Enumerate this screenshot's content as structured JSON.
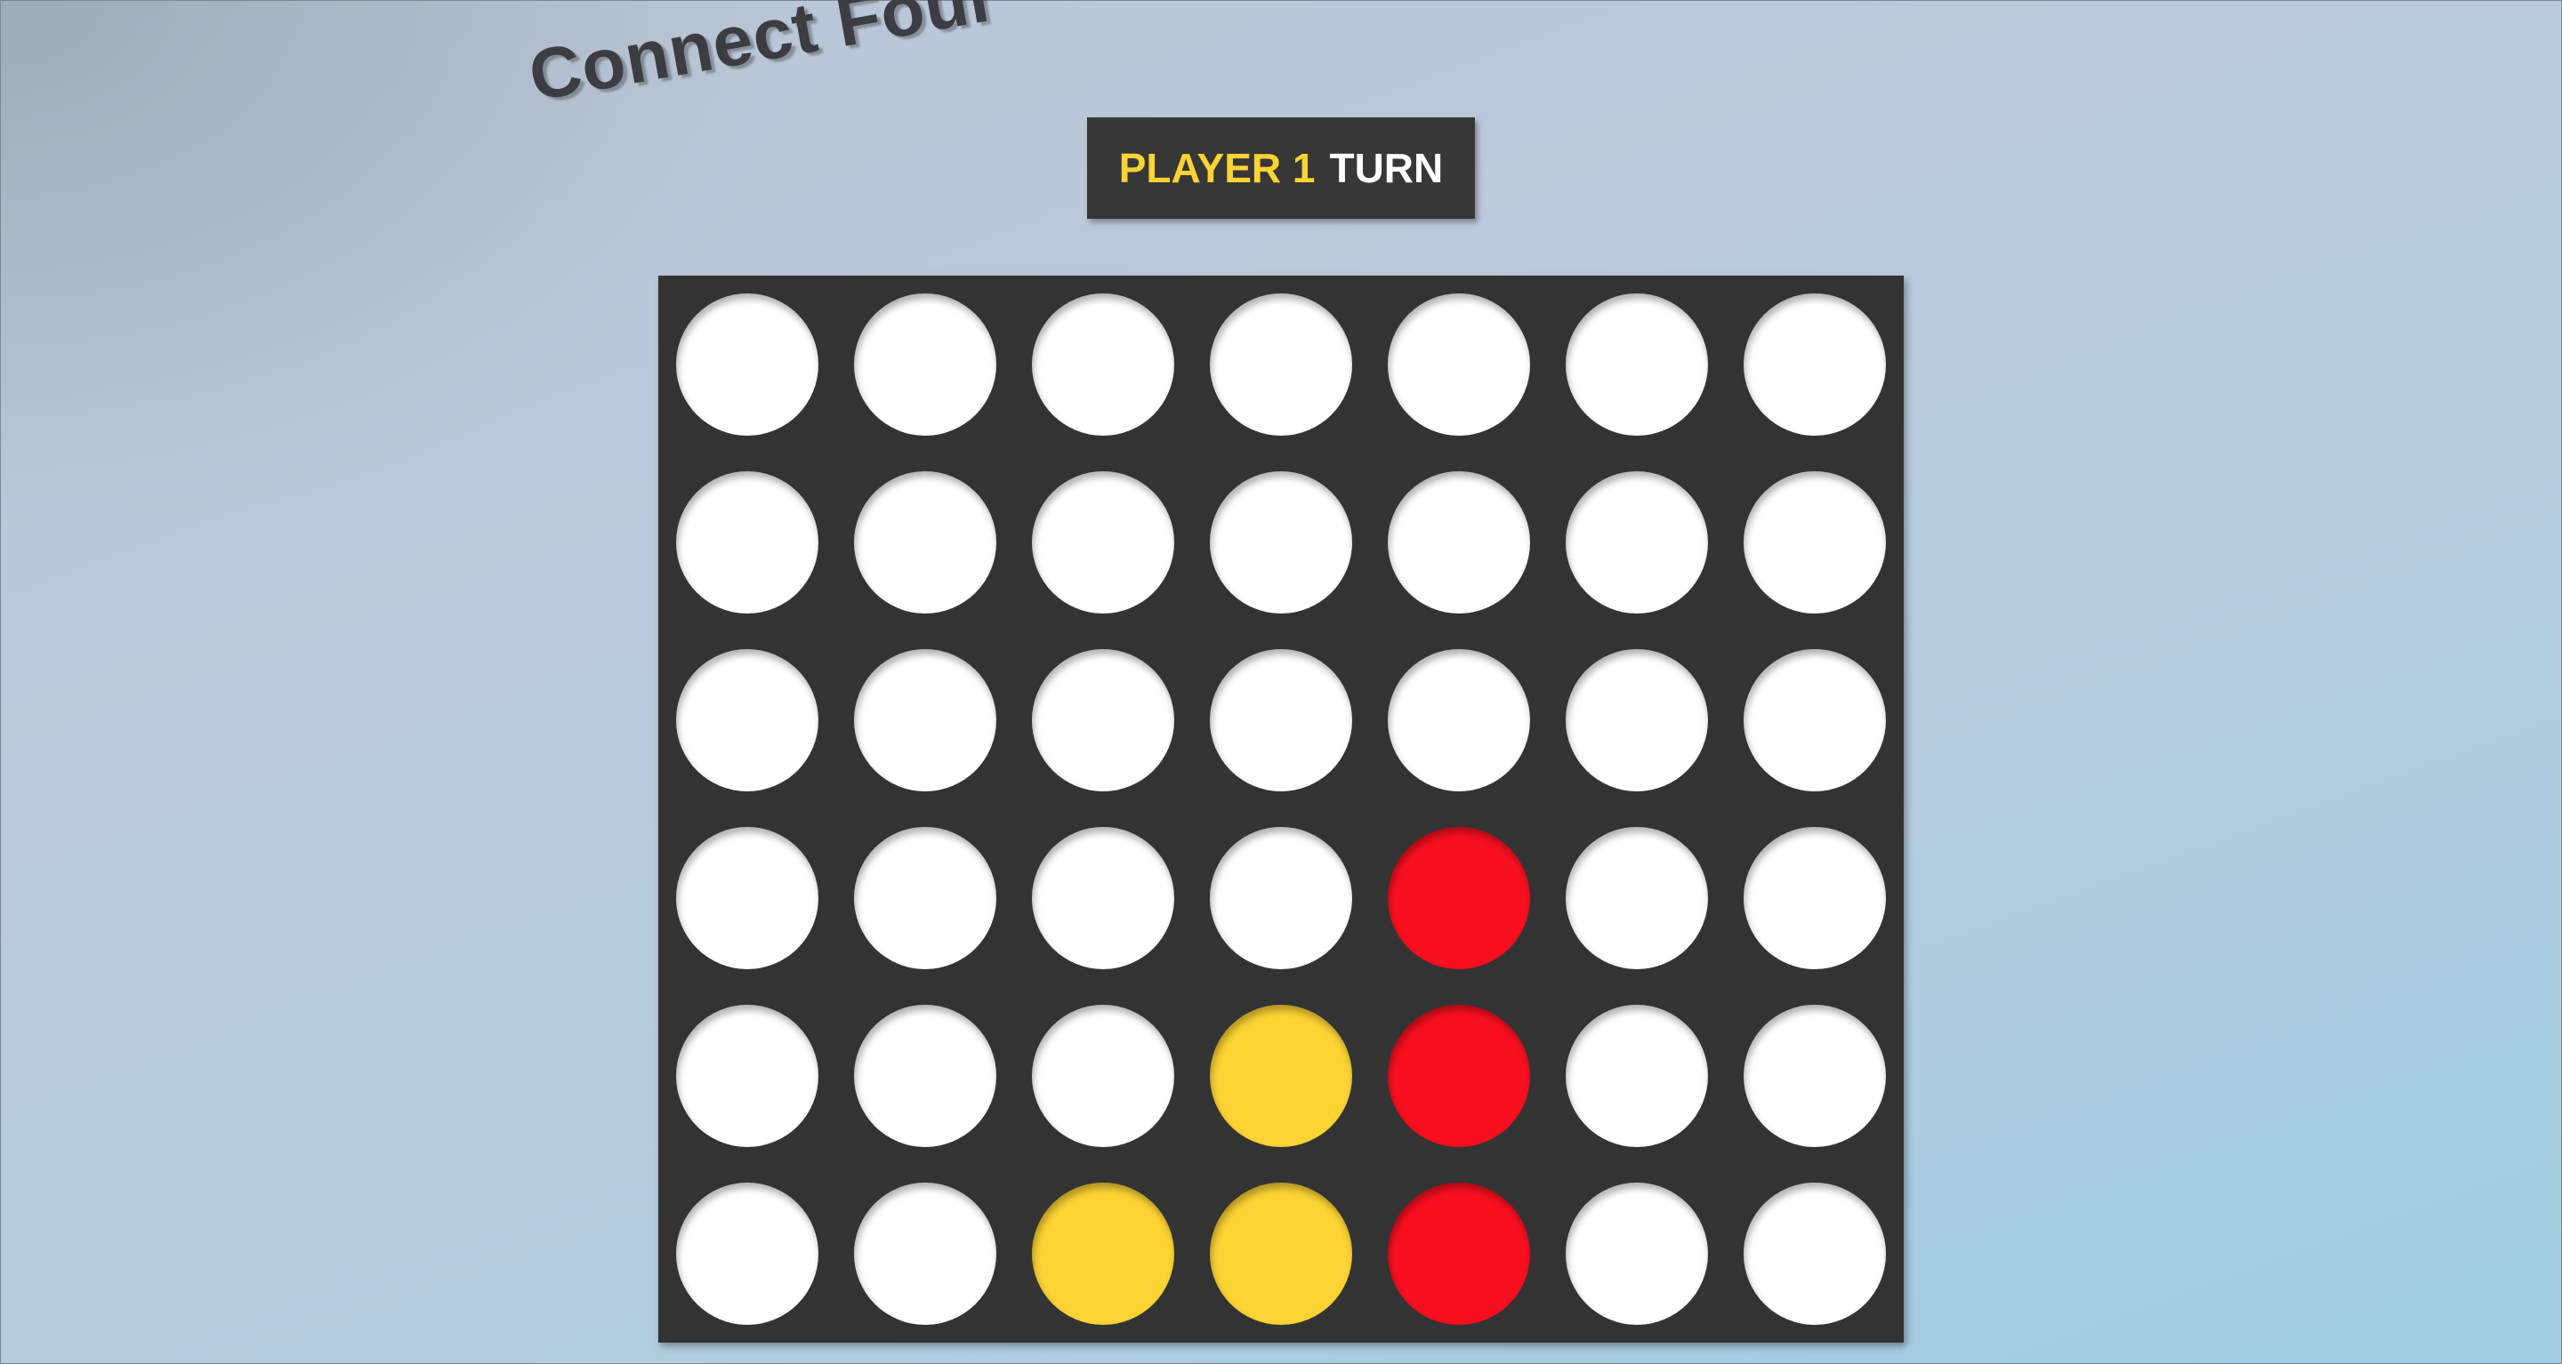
{
  "app": {
    "title": "Connect Four"
  },
  "status": {
    "player_label": "PLAYER 1",
    "turn_label": "TURN"
  },
  "colors": {
    "board": "#333333",
    "empty": "#ffffff",
    "player1": "#fdd434",
    "player2": "#f80f1f",
    "background_start": "#b9c5d5",
    "background_end": "#9fcce1"
  },
  "board": {
    "rows": 6,
    "columns": 7,
    "cells": [
      [
        "empty",
        "empty",
        "empty",
        "empty",
        "empty",
        "empty",
        "empty"
      ],
      [
        "empty",
        "empty",
        "empty",
        "empty",
        "empty",
        "empty",
        "empty"
      ],
      [
        "empty",
        "empty",
        "empty",
        "empty",
        "empty",
        "empty",
        "empty"
      ],
      [
        "empty",
        "empty",
        "empty",
        "empty",
        "red",
        "empty",
        "empty"
      ],
      [
        "empty",
        "empty",
        "empty",
        "yellow",
        "red",
        "empty",
        "empty"
      ],
      [
        "empty",
        "empty",
        "yellow",
        "yellow",
        "red",
        "empty",
        "empty"
      ]
    ]
  }
}
